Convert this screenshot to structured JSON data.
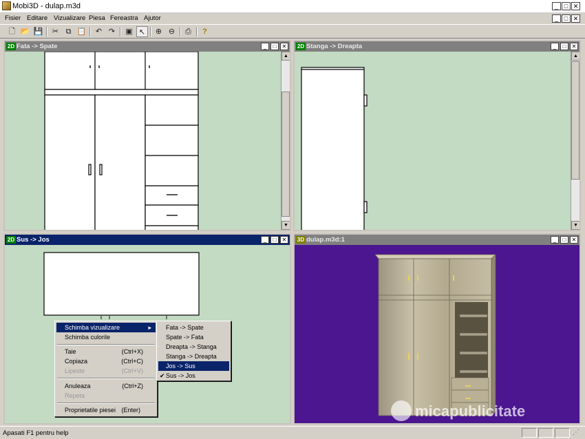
{
  "app": {
    "title": "Mobi3D - dulap.m3d"
  },
  "menu": [
    "Fisier",
    "Editare",
    "Vizualizare",
    "Piesa",
    "Fereastra",
    "Ajutor"
  ],
  "toolbar": {
    "icons": [
      "new-icon",
      "open-icon",
      "save-icon",
      "cut-icon",
      "copy-icon",
      "paste-icon",
      "undo-icon",
      "redo-icon",
      "add-piece-icon",
      "select-pointer-icon",
      "zoom-in-icon",
      "zoom-out-icon",
      "print-icon",
      "help-icon"
    ]
  },
  "windows": {
    "front": {
      "badge": "2D",
      "title": "Fata -> Spate"
    },
    "left": {
      "badge": "2D",
      "title": "Stanga -> Dreapta"
    },
    "top": {
      "badge": "2D",
      "title": "Sus -> Jos"
    },
    "view3d": {
      "badge": "3D",
      "title": "dulap.m3d:1"
    }
  },
  "context_menu": {
    "items": [
      {
        "label": "Schimba vizualizare",
        "shortcut": "",
        "state": "highlighted",
        "submenu": true
      },
      {
        "label": "Schimba culorile",
        "shortcut": "",
        "state": "normal"
      },
      {
        "label": "Taie",
        "shortcut": "(Ctrl+X)",
        "state": "normal"
      },
      {
        "label": "Copiaza",
        "shortcut": "(Ctrl+C)",
        "state": "normal"
      },
      {
        "label": "Lipeste",
        "shortcut": "(Ctrl+V)",
        "state": "disabled"
      },
      {
        "label": "Anuleaza",
        "shortcut": "(Ctrl+Z)",
        "state": "normal"
      },
      {
        "label": "Repeta",
        "shortcut": "",
        "state": "disabled"
      },
      {
        "label": "Proprietatile piesei",
        "shortcut": "(Enter)",
        "state": "normal"
      }
    ]
  },
  "submenu": {
    "items": [
      {
        "label": "Fata -> Spate",
        "checked": false,
        "highlighted": false
      },
      {
        "label": "Spate -> Fata",
        "checked": false,
        "highlighted": false
      },
      {
        "label": "Dreapta -> Stanga",
        "checked": false,
        "highlighted": false
      },
      {
        "label": "Stanga -> Dreapta",
        "checked": false,
        "highlighted": false
      },
      {
        "label": "Jos -> Sus",
        "checked": false,
        "highlighted": true
      },
      {
        "label": "Sus -> Jos",
        "checked": true,
        "highlighted": false
      }
    ]
  },
  "status": {
    "text": "Apasati  F1 pentru help"
  },
  "watermark": {
    "text": "micapublicitate"
  },
  "colors": {
    "canvas_bg": "#c3dac3",
    "view3d_bg": "#4b1690",
    "active_title": "#0a246a"
  }
}
